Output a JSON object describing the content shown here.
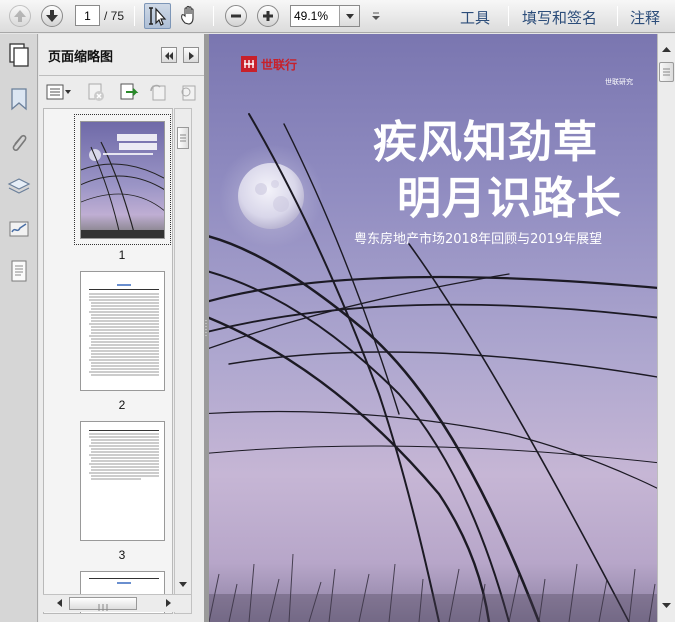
{
  "toolbar": {
    "page_current": "1",
    "page_total": "/ 75",
    "zoom_value": "49.1%",
    "tools_label": "工具",
    "fill_sign_label": "填写和签名",
    "comment_label": "注释"
  },
  "thumbnail_panel": {
    "title": "页面缩略图",
    "thumbnails": [
      {
        "label": "1"
      },
      {
        "label": "2"
      },
      {
        "label": "3"
      }
    ]
  },
  "cover": {
    "brand": "世联行",
    "research_label": "世联研究",
    "title_line1": "疾风知劲草",
    "title_line2": "明月识路长",
    "subtitle": "粤东房地产市场2018年回顾与2019年展望"
  },
  "colors": {
    "brand_red": "#c8202a",
    "link_blue": "#2c4d7a",
    "sky_top": "#7a76b0",
    "sky_low": "#c6b6d5"
  }
}
